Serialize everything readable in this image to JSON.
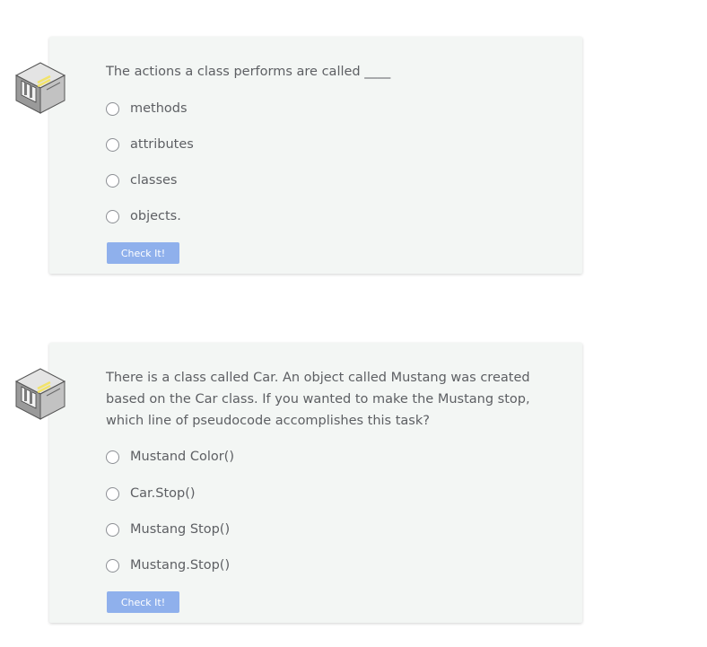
{
  "quizzes": [
    {
      "question": "The actions a class performs are called ____",
      "options": [
        "methods",
        "attributes",
        "classes",
        "objects."
      ],
      "check_label": "Check It!",
      "icon": "quiz-robot-icon"
    },
    {
      "question": "There is a class called Car. An object called Mustang was created based on the Car class. If you wanted to make the Mustang stop, which line of pseudocode accomplishes this task?",
      "options": [
        "Mustand Color()",
        "Car.Stop()",
        "Mustang Stop()",
        "Mustang.Stop()"
      ],
      "check_label": "Check It!",
      "icon": "quiz-robot-icon"
    }
  ],
  "colors": {
    "card_background": "#f3f6f4",
    "button_background": "#8fb0ec",
    "text": "#5d5f63"
  }
}
